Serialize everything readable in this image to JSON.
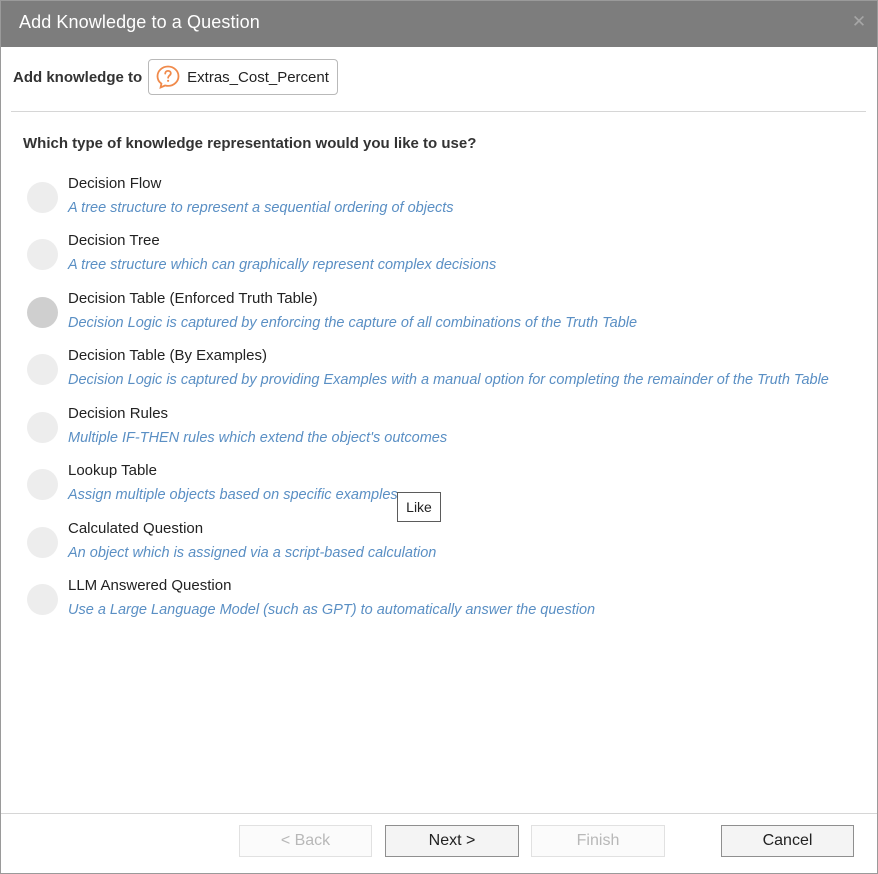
{
  "dialog": {
    "title": "Add Knowledge to a Question",
    "close_icon": "close-icon"
  },
  "target": {
    "label": "Add knowledge to",
    "question_name": "Extras_Cost_Percent",
    "icon": "question-bubble-icon",
    "icon_color": "#f08a4b"
  },
  "question": "Which type of knowledge representation would you like to use?",
  "options": [
    {
      "title": "Decision Flow",
      "desc": "A tree structure to represent a sequential ordering of objects"
    },
    {
      "title": "Decision Tree",
      "desc": "A tree structure which can graphically represent complex decisions"
    },
    {
      "title": "Decision Table (Enforced Truth Table)",
      "desc": "Decision Logic is captured by enforcing the capture of all combinations of the Truth Table"
    },
    {
      "title": "Decision Table (By Examples)",
      "desc": "Decision Logic is captured by providing Examples with a manual option for completing the remainder of the Truth Table"
    },
    {
      "title": "Decision Rules",
      "desc": "Multiple IF-THEN rules which extend the object's outcomes"
    },
    {
      "title": "Lookup Table",
      "desc": "Assign multiple objects based on specific examples"
    },
    {
      "title": "Calculated Question",
      "desc": "An object which is assigned via a script-based calculation"
    },
    {
      "title": "LLM Answered Question",
      "desc": "Use a Large Language Model (such as GPT) to automatically answer the question"
    }
  ],
  "tooltip": "Like",
  "buttons": {
    "back": "< Back",
    "next": "Next >",
    "finish": "Finish",
    "cancel": "Cancel"
  },
  "colors": {
    "titlebar": "#7d7d7d",
    "description": "#5a8fc4"
  }
}
